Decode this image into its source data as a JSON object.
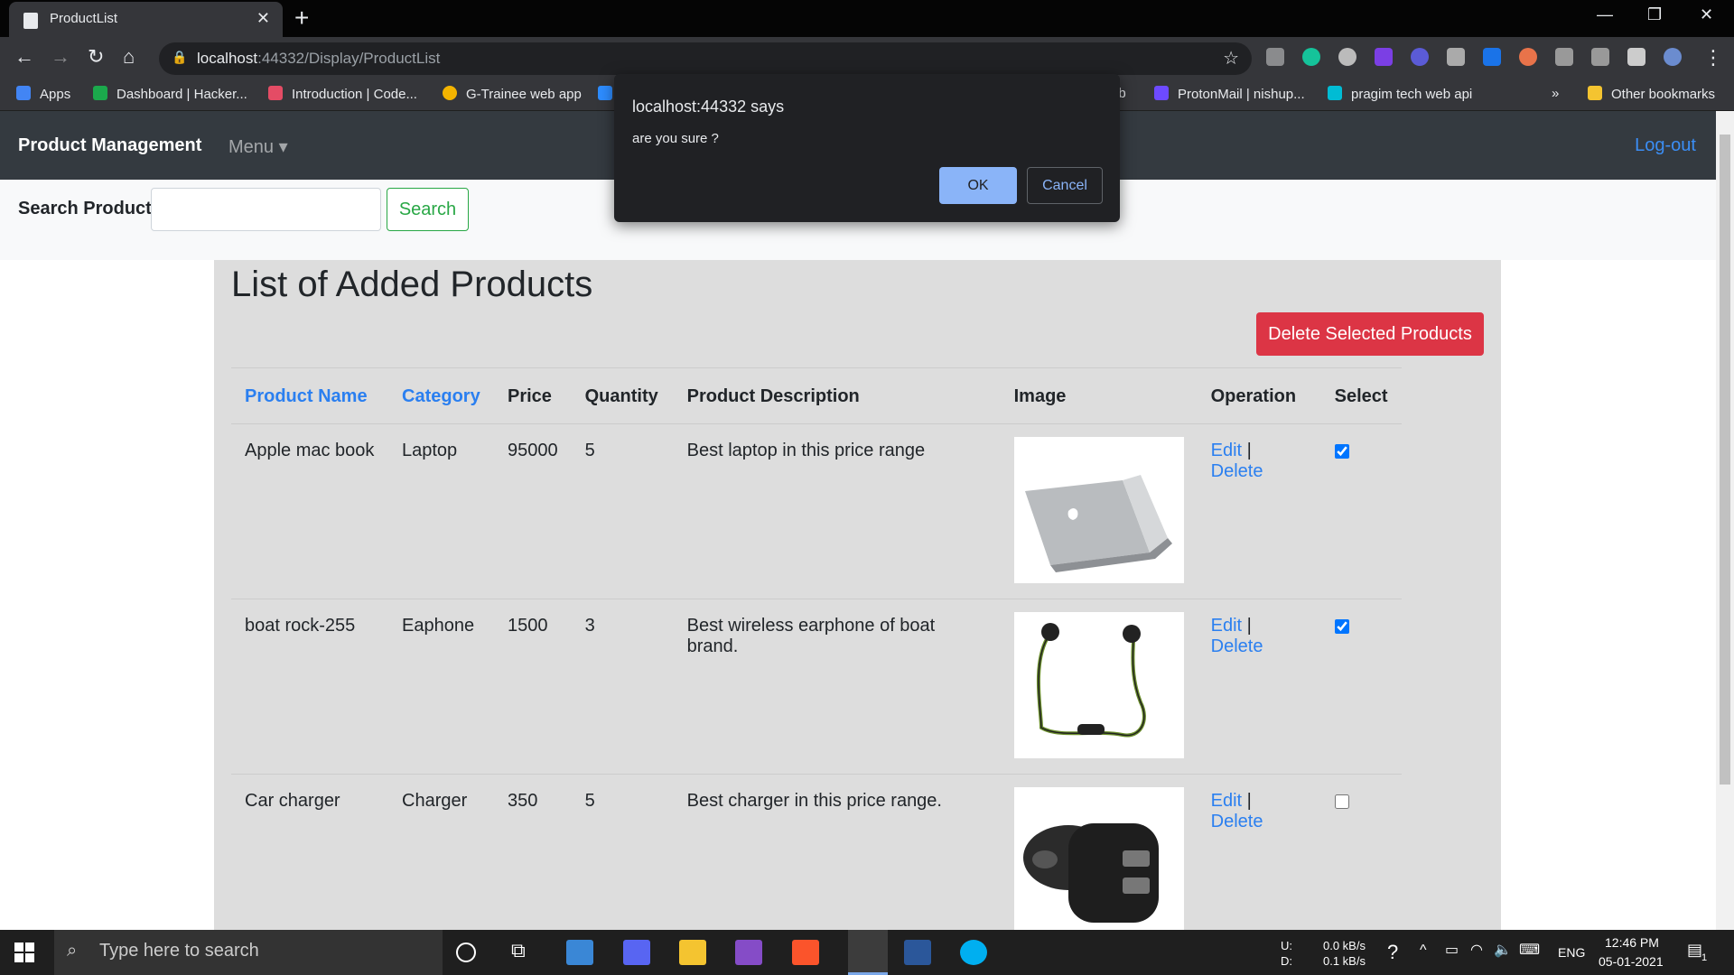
{
  "browser": {
    "tab_title": "ProductList",
    "url_host": "localhost",
    "url_rest": ":44332/Display/ProductList",
    "bookmarks": [
      {
        "label": "Apps",
        "color": "#4285f4"
      },
      {
        "label": "Dashboard | Hacker...",
        "color": "#1ba94c"
      },
      {
        "label": "Introduction | Code...",
        "color": "#e44c65"
      },
      {
        "label": "G-Trainee web app",
        "color": "#f4b400"
      },
      {
        "label": "",
        "color": "#2d8cff"
      },
      {
        "label": "ub",
        "color": "#35363a"
      },
      {
        "label": "ProtonMail | nishup...",
        "color": "#6d4aff"
      },
      {
        "label": "pragim tech web api",
        "color": "#00bcd4"
      }
    ],
    "more_bookmarks": "»",
    "other_bookmarks": "Other bookmarks"
  },
  "app": {
    "brand": "Product Management",
    "menu": "Menu ▾",
    "logout": "Log-out",
    "search_label": "Search Product",
    "search_value": "",
    "search_button": "Search",
    "heading": "List of Added Products",
    "delete_selected": "Delete Selected Products"
  },
  "table": {
    "headers": [
      "Product Name",
      "Category",
      "Price",
      "Quantity",
      "Product Description",
      "Image",
      "Operation",
      "Select"
    ],
    "edit_label": "Edit",
    "sep": "|",
    "delete_label": "Delete",
    "rows": [
      {
        "name": "Apple mac book",
        "category": "Laptop",
        "price": "95000",
        "quantity": "5",
        "description": "Best laptop in this price range",
        "image": "laptop",
        "selected": true
      },
      {
        "name": "boat rock-255",
        "category": "Eaphone",
        "price": "1500",
        "quantity": "3",
        "description": "Best wireless earphone of boat brand.",
        "image": "earphone",
        "selected": true
      },
      {
        "name": "Car charger",
        "category": "Charger",
        "price": "350",
        "quantity": "5",
        "description": "Best charger in this price range.",
        "image": "charger",
        "selected": false
      }
    ]
  },
  "dialog": {
    "title": "localhost:44332 says",
    "message": "are you sure ?",
    "ok": "OK",
    "cancel": "Cancel"
  },
  "taskbar": {
    "search_placeholder": "Type here to search",
    "net_up_label": "U:",
    "net_down_label": "D:",
    "net_up": "0.0 kB/s",
    "net_down": "0.1 kB/s",
    "lang": "ENG",
    "time": "12:46 PM",
    "date": "05-01-2021",
    "notifications": "1"
  }
}
